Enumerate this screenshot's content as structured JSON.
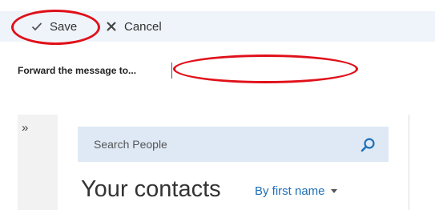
{
  "toolbar": {
    "save_label": "Save",
    "cancel_label": "Cancel"
  },
  "forward": {
    "label": "Forward the message to...",
    "value": ""
  },
  "rail": {
    "expand_label": "»"
  },
  "people": {
    "search_placeholder": "Search People",
    "title": "Your contacts",
    "sort_label": "By first name"
  },
  "colors": {
    "toolbar_bg": "#eef4fa",
    "search_bg": "#dfe9f6",
    "link_blue": "#1e6fb8",
    "highlight_red": "#e0101a"
  },
  "icons": {
    "save": "checkmark-icon",
    "cancel": "close-icon",
    "search": "search-icon",
    "sort": "caret-down-icon"
  }
}
